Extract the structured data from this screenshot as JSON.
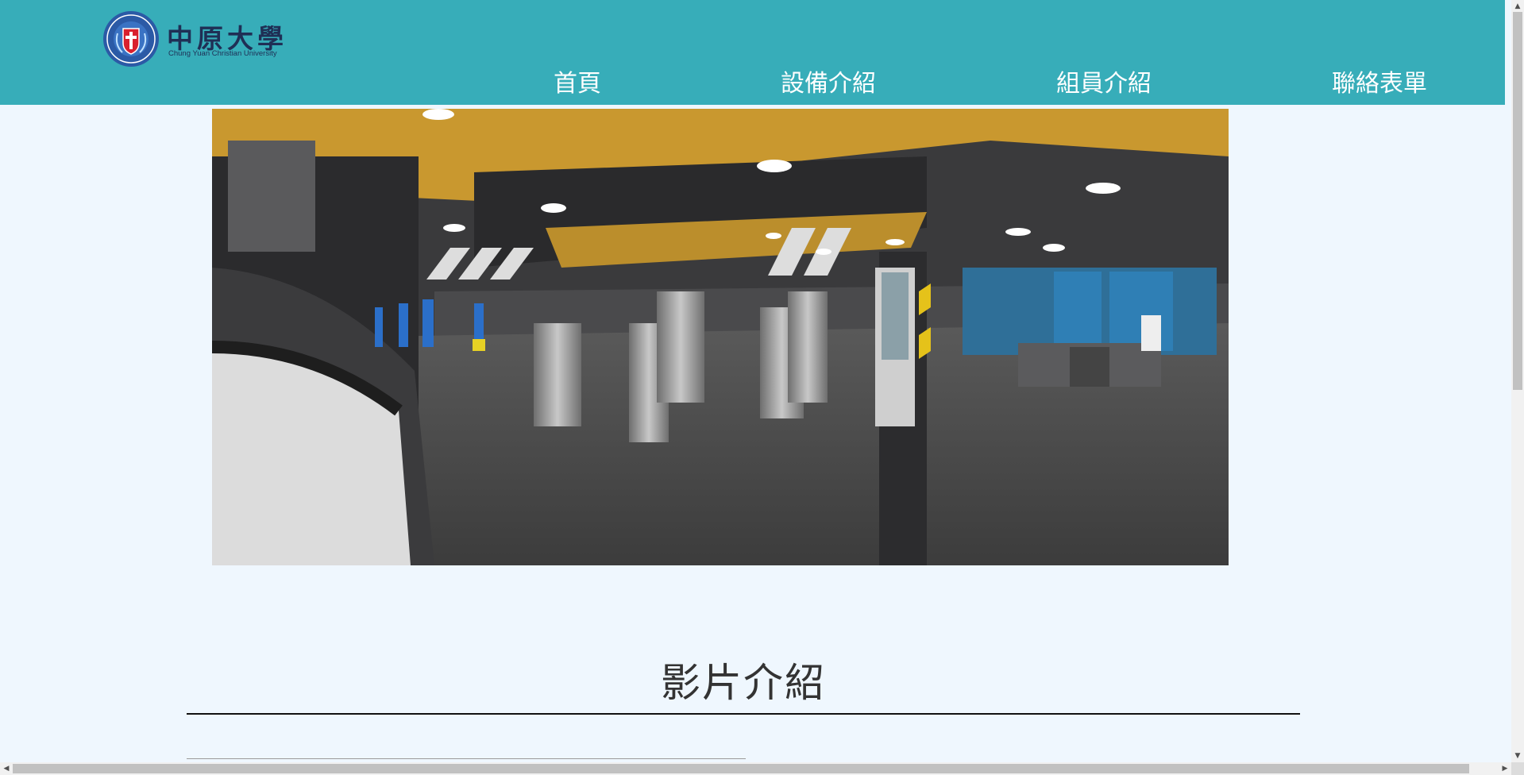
{
  "header": {
    "logo": {
      "title": "中原大學",
      "subtitle": "Chung Yuan Christian University"
    },
    "nav": [
      {
        "label": "首頁"
      },
      {
        "label": "設備介紹"
      },
      {
        "label": "組員介紹"
      },
      {
        "label": "聯絡表單"
      }
    ]
  },
  "main": {
    "hero_image": {
      "alt": "Gym interior with fitness equipment"
    },
    "video_section": {
      "title": "影片介紹"
    }
  },
  "colors": {
    "header_bg": "#37adb9",
    "page_bg": "#eff7fe",
    "nav_text": "#ffffff"
  },
  "icons": {
    "logo_emblem": "university-emblem-icon",
    "scroll_up": "scroll-up-arrow-icon",
    "scroll_down": "scroll-down-arrow-icon",
    "scroll_left": "scroll-left-arrow-icon",
    "scroll_right": "scroll-right-arrow-icon"
  }
}
